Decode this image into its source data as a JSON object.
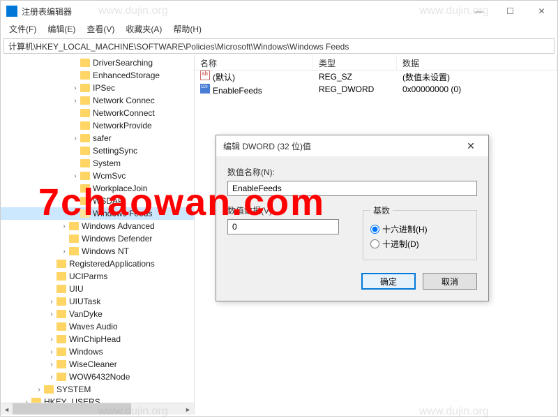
{
  "window": {
    "title": "注册表编辑器"
  },
  "menu": {
    "file": "文件(F)",
    "edit": "编辑(E)",
    "view": "查看(V)",
    "favorites": "收藏夹(A)",
    "help": "帮助(H)"
  },
  "address": "计算机\\HKEY_LOCAL_MACHINE\\SOFTWARE\\Policies\\Microsoft\\Windows\\Windows Feeds",
  "tree": [
    {
      "indent": 100,
      "expander": "",
      "label": "DriverSearching"
    },
    {
      "indent": 100,
      "expander": "",
      "label": "EnhancedStorage"
    },
    {
      "indent": 100,
      "expander": "›",
      "label": "IPSec"
    },
    {
      "indent": 100,
      "expander": "›",
      "label": "Network Connec"
    },
    {
      "indent": 100,
      "expander": "",
      "label": "NetworkConnect"
    },
    {
      "indent": 100,
      "expander": "",
      "label": "NetworkProvide"
    },
    {
      "indent": 100,
      "expander": "›",
      "label": "safer"
    },
    {
      "indent": 100,
      "expander": "",
      "label": "SettingSync"
    },
    {
      "indent": 100,
      "expander": "",
      "label": "System"
    },
    {
      "indent": 100,
      "expander": "›",
      "label": "WcmSvc"
    },
    {
      "indent": 100,
      "expander": "",
      "label": "WorkplaceJoin"
    },
    {
      "indent": 100,
      "expander": "",
      "label": "WSDAPI"
    },
    {
      "indent": 100,
      "expander": "",
      "label": "Windows Feeds",
      "selected": true
    },
    {
      "indent": 84,
      "expander": "›",
      "label": "Windows Advanced"
    },
    {
      "indent": 84,
      "expander": "",
      "label": "Windows Defender"
    },
    {
      "indent": 84,
      "expander": "›",
      "label": "Windows NT"
    },
    {
      "indent": 66,
      "expander": "",
      "label": "RegisteredApplications"
    },
    {
      "indent": 66,
      "expander": "",
      "label": "UCIParms"
    },
    {
      "indent": 66,
      "expander": "",
      "label": "UIU"
    },
    {
      "indent": 66,
      "expander": "›",
      "label": "UIUTask"
    },
    {
      "indent": 66,
      "expander": "›",
      "label": "VanDyke"
    },
    {
      "indent": 66,
      "expander": "",
      "label": "Waves Audio"
    },
    {
      "indent": 66,
      "expander": "›",
      "label": "WinChipHead"
    },
    {
      "indent": 66,
      "expander": "›",
      "label": "Windows"
    },
    {
      "indent": 66,
      "expander": "›",
      "label": "WiseCleaner"
    },
    {
      "indent": 66,
      "expander": "›",
      "label": "WOW6432Node"
    },
    {
      "indent": 48,
      "expander": "›",
      "label": "SYSTEM"
    },
    {
      "indent": 30,
      "expander": "›",
      "label": "HKEY_USERS"
    }
  ],
  "list": {
    "headers": {
      "name": "名称",
      "type": "类型",
      "data": "数据"
    },
    "rows": [
      {
        "icon": "string",
        "name": "(默认)",
        "type": "REG_SZ",
        "data": "(数值未设置)"
      },
      {
        "icon": "dword",
        "name": "EnableFeeds",
        "type": "REG_DWORD",
        "data": "0x00000000 (0)"
      }
    ]
  },
  "dialog": {
    "title": "编辑 DWORD (32 位)值",
    "name_label": "数值名称(N):",
    "name_value": "EnableFeeds",
    "data_label": "数值数据(V):",
    "data_value": "0",
    "base_label": "基数",
    "radix_hex": "十六进制(H)",
    "radix_dec": "十进制(D)",
    "ok": "确定",
    "cancel": "取消"
  },
  "watermark": "7chaowan.com",
  "wm_dujin": "www.dujin.org"
}
